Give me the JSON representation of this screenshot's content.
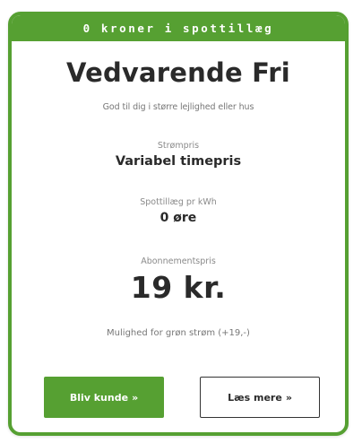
{
  "banner": {
    "text": "0 kroner i spottillæg"
  },
  "plan": {
    "name": "Vedvarende Fri",
    "description": "God til dig i større lejlighed eller hus"
  },
  "details": {
    "power_price": {
      "label": "Strømpris",
      "value": "Variabel timepris"
    },
    "spot_fee": {
      "label": "Spottillæg pr kWh",
      "value": "0 øre"
    },
    "subscription": {
      "label": "Abonnementspris",
      "value": "19 kr."
    }
  },
  "green_option": {
    "text": "Mulighed for grøn strøm (+19,-)"
  },
  "actions": {
    "primary_label": "Bliv kunde",
    "secondary_label": "Læs mere",
    "chevron_glyph": "»"
  },
  "colors": {
    "brand_green": "#56a032",
    "text_dark": "#2a2a2a",
    "text_muted": "#777777"
  },
  "icons": {
    "primary_arrow": "double-chevron-right-icon",
    "secondary_arrow": "double-chevron-right-icon"
  }
}
